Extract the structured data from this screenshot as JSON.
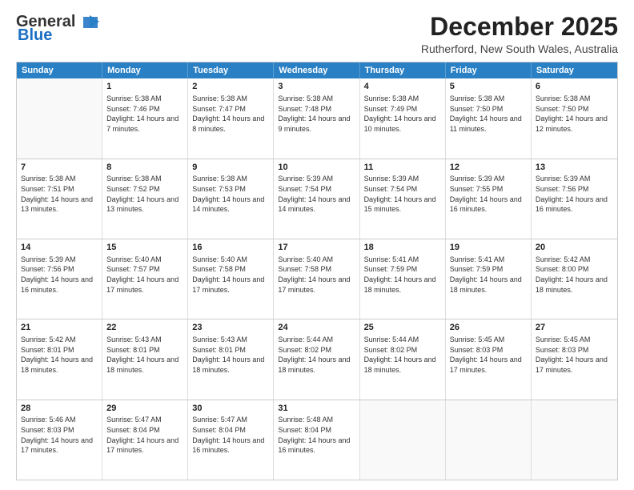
{
  "header": {
    "logo_general": "General",
    "logo_blue": "Blue",
    "month_title": "December 2025",
    "location": "Rutherford, New South Wales, Australia"
  },
  "days_of_week": [
    "Sunday",
    "Monday",
    "Tuesday",
    "Wednesday",
    "Thursday",
    "Friday",
    "Saturday"
  ],
  "weeks": [
    [
      {
        "day": "",
        "empty": true
      },
      {
        "day": "1",
        "sunrise": "Sunrise: 5:38 AM",
        "sunset": "Sunset: 7:46 PM",
        "daylight": "Daylight: 14 hours and 7 minutes."
      },
      {
        "day": "2",
        "sunrise": "Sunrise: 5:38 AM",
        "sunset": "Sunset: 7:47 PM",
        "daylight": "Daylight: 14 hours and 8 minutes."
      },
      {
        "day": "3",
        "sunrise": "Sunrise: 5:38 AM",
        "sunset": "Sunset: 7:48 PM",
        "daylight": "Daylight: 14 hours and 9 minutes."
      },
      {
        "day": "4",
        "sunrise": "Sunrise: 5:38 AM",
        "sunset": "Sunset: 7:49 PM",
        "daylight": "Daylight: 14 hours and 10 minutes."
      },
      {
        "day": "5",
        "sunrise": "Sunrise: 5:38 AM",
        "sunset": "Sunset: 7:50 PM",
        "daylight": "Daylight: 14 hours and 11 minutes."
      },
      {
        "day": "6",
        "sunrise": "Sunrise: 5:38 AM",
        "sunset": "Sunset: 7:50 PM",
        "daylight": "Daylight: 14 hours and 12 minutes."
      }
    ],
    [
      {
        "day": "7",
        "sunrise": "Sunrise: 5:38 AM",
        "sunset": "Sunset: 7:51 PM",
        "daylight": "Daylight: 14 hours and 13 minutes."
      },
      {
        "day": "8",
        "sunrise": "Sunrise: 5:38 AM",
        "sunset": "Sunset: 7:52 PM",
        "daylight": "Daylight: 14 hours and 13 minutes."
      },
      {
        "day": "9",
        "sunrise": "Sunrise: 5:38 AM",
        "sunset": "Sunset: 7:53 PM",
        "daylight": "Daylight: 14 hours and 14 minutes."
      },
      {
        "day": "10",
        "sunrise": "Sunrise: 5:39 AM",
        "sunset": "Sunset: 7:54 PM",
        "daylight": "Daylight: 14 hours and 14 minutes."
      },
      {
        "day": "11",
        "sunrise": "Sunrise: 5:39 AM",
        "sunset": "Sunset: 7:54 PM",
        "daylight": "Daylight: 14 hours and 15 minutes."
      },
      {
        "day": "12",
        "sunrise": "Sunrise: 5:39 AM",
        "sunset": "Sunset: 7:55 PM",
        "daylight": "Daylight: 14 hours and 16 minutes."
      },
      {
        "day": "13",
        "sunrise": "Sunrise: 5:39 AM",
        "sunset": "Sunset: 7:56 PM",
        "daylight": "Daylight: 14 hours and 16 minutes."
      }
    ],
    [
      {
        "day": "14",
        "sunrise": "Sunrise: 5:39 AM",
        "sunset": "Sunset: 7:56 PM",
        "daylight": "Daylight: 14 hours and 16 minutes."
      },
      {
        "day": "15",
        "sunrise": "Sunrise: 5:40 AM",
        "sunset": "Sunset: 7:57 PM",
        "daylight": "Daylight: 14 hours and 17 minutes."
      },
      {
        "day": "16",
        "sunrise": "Sunrise: 5:40 AM",
        "sunset": "Sunset: 7:58 PM",
        "daylight": "Daylight: 14 hours and 17 minutes."
      },
      {
        "day": "17",
        "sunrise": "Sunrise: 5:40 AM",
        "sunset": "Sunset: 7:58 PM",
        "daylight": "Daylight: 14 hours and 17 minutes."
      },
      {
        "day": "18",
        "sunrise": "Sunrise: 5:41 AM",
        "sunset": "Sunset: 7:59 PM",
        "daylight": "Daylight: 14 hours and 18 minutes."
      },
      {
        "day": "19",
        "sunrise": "Sunrise: 5:41 AM",
        "sunset": "Sunset: 7:59 PM",
        "daylight": "Daylight: 14 hours and 18 minutes."
      },
      {
        "day": "20",
        "sunrise": "Sunrise: 5:42 AM",
        "sunset": "Sunset: 8:00 PM",
        "daylight": "Daylight: 14 hours and 18 minutes."
      }
    ],
    [
      {
        "day": "21",
        "sunrise": "Sunrise: 5:42 AM",
        "sunset": "Sunset: 8:01 PM",
        "daylight": "Daylight: 14 hours and 18 minutes."
      },
      {
        "day": "22",
        "sunrise": "Sunrise: 5:43 AM",
        "sunset": "Sunset: 8:01 PM",
        "daylight": "Daylight: 14 hours and 18 minutes."
      },
      {
        "day": "23",
        "sunrise": "Sunrise: 5:43 AM",
        "sunset": "Sunset: 8:01 PM",
        "daylight": "Daylight: 14 hours and 18 minutes."
      },
      {
        "day": "24",
        "sunrise": "Sunrise: 5:44 AM",
        "sunset": "Sunset: 8:02 PM",
        "daylight": "Daylight: 14 hours and 18 minutes."
      },
      {
        "day": "25",
        "sunrise": "Sunrise: 5:44 AM",
        "sunset": "Sunset: 8:02 PM",
        "daylight": "Daylight: 14 hours and 18 minutes."
      },
      {
        "day": "26",
        "sunrise": "Sunrise: 5:45 AM",
        "sunset": "Sunset: 8:03 PM",
        "daylight": "Daylight: 14 hours and 17 minutes."
      },
      {
        "day": "27",
        "sunrise": "Sunrise: 5:45 AM",
        "sunset": "Sunset: 8:03 PM",
        "daylight": "Daylight: 14 hours and 17 minutes."
      }
    ],
    [
      {
        "day": "28",
        "sunrise": "Sunrise: 5:46 AM",
        "sunset": "Sunset: 8:03 PM",
        "daylight": "Daylight: 14 hours and 17 minutes."
      },
      {
        "day": "29",
        "sunrise": "Sunrise: 5:47 AM",
        "sunset": "Sunset: 8:04 PM",
        "daylight": "Daylight: 14 hours and 17 minutes."
      },
      {
        "day": "30",
        "sunrise": "Sunrise: 5:47 AM",
        "sunset": "Sunset: 8:04 PM",
        "daylight": "Daylight: 14 hours and 16 minutes."
      },
      {
        "day": "31",
        "sunrise": "Sunrise: 5:48 AM",
        "sunset": "Sunset: 8:04 PM",
        "daylight": "Daylight: 14 hours and 16 minutes."
      },
      {
        "day": "",
        "empty": true
      },
      {
        "day": "",
        "empty": true
      },
      {
        "day": "",
        "empty": true
      }
    ]
  ]
}
